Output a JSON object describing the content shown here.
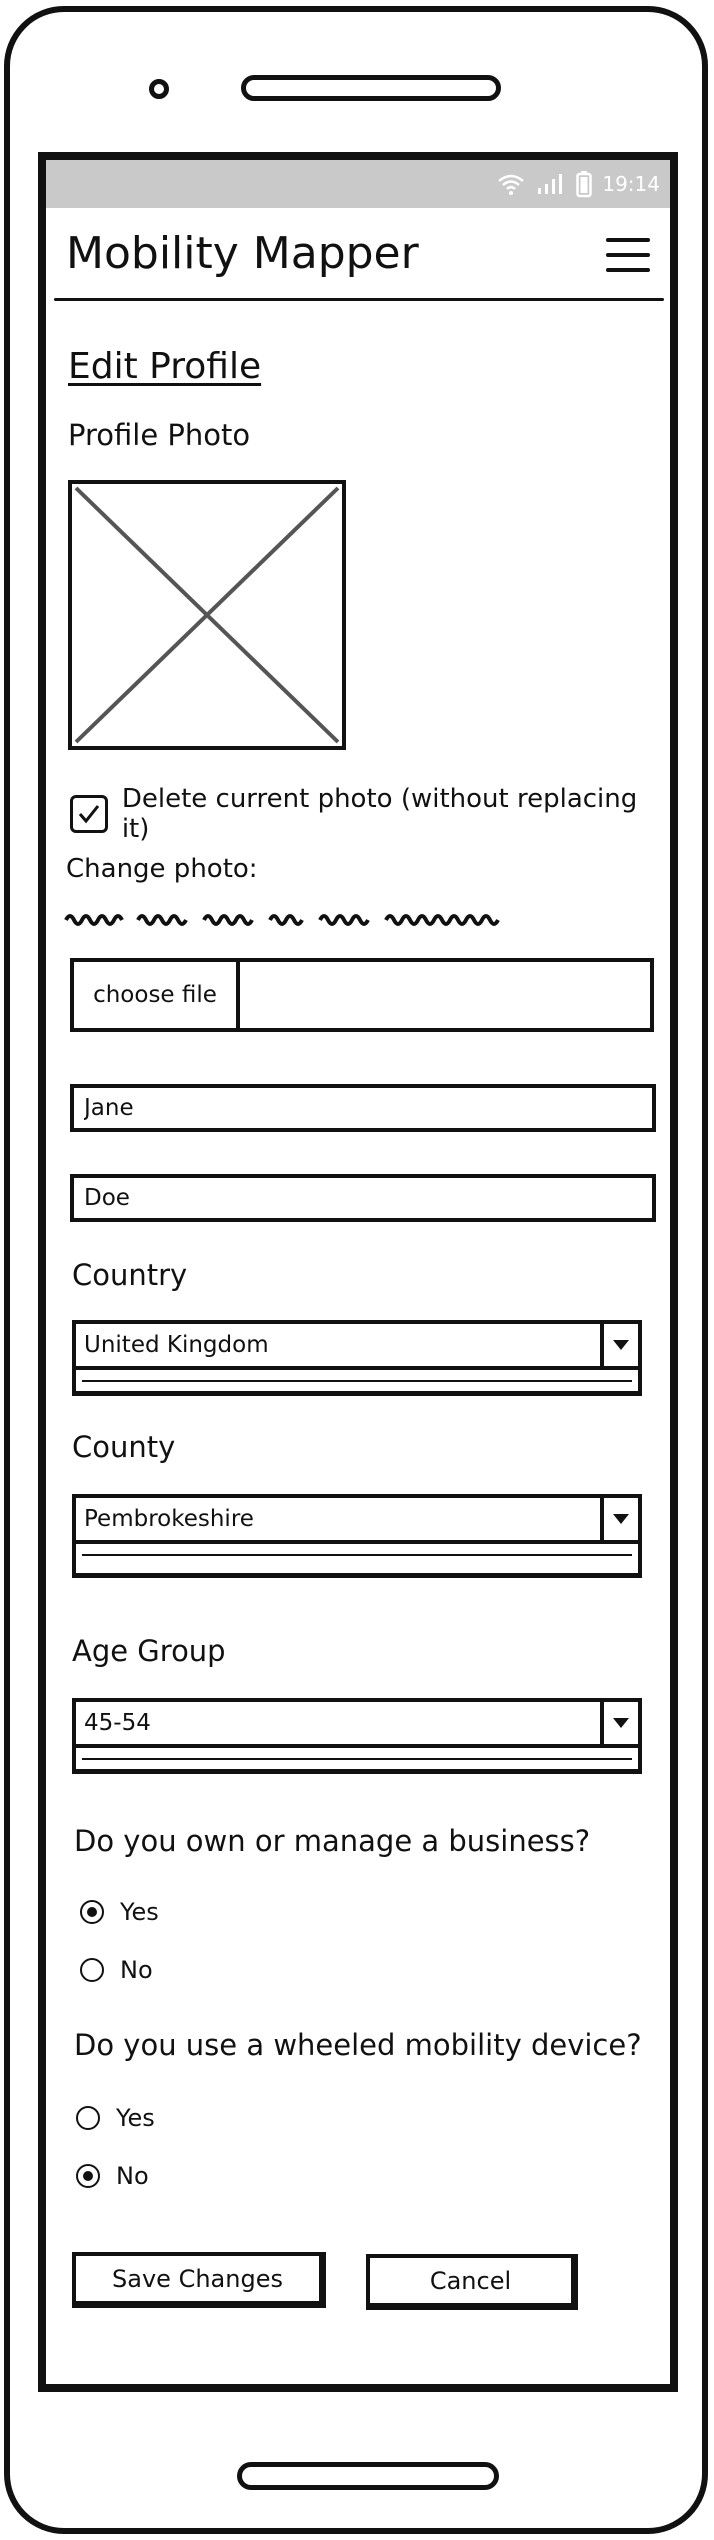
{
  "status_bar": {
    "time": "19:14"
  },
  "header": {
    "title": "Mobility Mapper"
  },
  "form": {
    "heading": "Edit Profile",
    "photo_label": "Profile Photo",
    "delete_photo": {
      "label": "Delete current photo (without replacing it)",
      "checked": true
    },
    "change_photo_label": "Change photo:",
    "file_picker": {
      "button_label": "choose file"
    },
    "first_name": "Jane",
    "last_name": "Doe",
    "country": {
      "label": "Country",
      "value": "United Kingdom"
    },
    "county": {
      "label": "County",
      "value": "Pembrokeshire"
    },
    "age_group": {
      "label": "Age Group",
      "value": "45-54"
    },
    "business_question": {
      "text": "Do you own or manage a business?",
      "options": [
        {
          "label": "Yes",
          "selected": true
        },
        {
          "label": "No",
          "selected": false
        }
      ]
    },
    "wheeled_question": {
      "text": "Do you use a wheeled mobility device?",
      "options": [
        {
          "label": "Yes",
          "selected": false
        },
        {
          "label": "No",
          "selected": true
        }
      ]
    },
    "actions": {
      "save_label": "Save Changes",
      "cancel_label": "Cancel"
    }
  }
}
